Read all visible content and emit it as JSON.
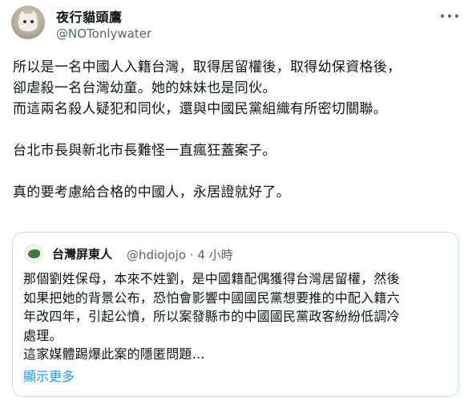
{
  "author": {
    "display_name": "夜行貓頭鷹",
    "handle": "@NOTonlywater",
    "avatar_icon": "cat-avatar"
  },
  "tweet": {
    "lines": [
      "所以是一名中國人入籍台灣，取得居留權後，取得幼保資格後，",
      "卻虐殺一名台灣幼童。她的妹妹也是同伙。",
      "而這兩名殺人疑犯和同伙，還與中國民黨組織有所密切關聯。",
      "",
      "台北市長與新北市長難怪一直瘋狂蓋案子。",
      "",
      "真的要考慮給合格的中國人，永居證就好了。"
    ]
  },
  "quote": {
    "display_name": "台灣屏東人",
    "handle_time": "@hdiojojo · 4 小時",
    "avatar_icon": "leaf-avatar",
    "lines": [
      "那個劉姓保母，本來不姓劉，是中國籍配偶獲得台灣居留權，然後",
      "如果把她的背景公布，恐怕會影響中國國民黨想要推的中配入籍六",
      "年改四年，引起公憤，所以案發縣市的中國國民黨政客紛紛低調冷",
      "處理。",
      "這家媒體踢爆此案的隱匿問題…"
    ],
    "show_more": "顯示更多",
    "link_color": "#1d9bf0"
  },
  "colors": {
    "text": "#0f1419",
    "secondary": "#536471",
    "border": "#cfd9de"
  }
}
